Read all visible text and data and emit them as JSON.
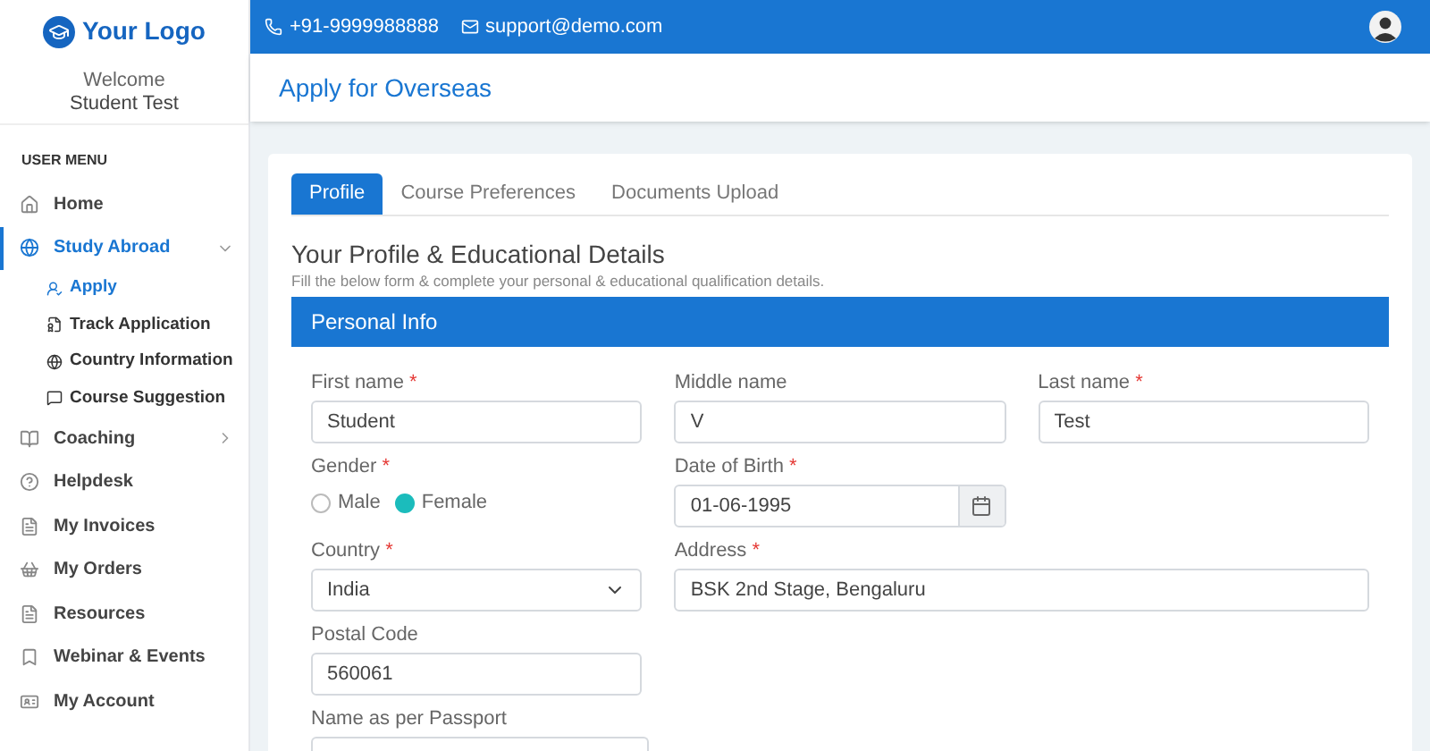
{
  "logo": {
    "text": "Your Logo"
  },
  "topbar": {
    "phone": "+91-9999988888",
    "email": "support@demo.com"
  },
  "welcome": {
    "greeting": "Welcome",
    "name": "Student Test"
  },
  "sidebar": {
    "heading": "USER MENU",
    "items": [
      {
        "label": "Home",
        "selected": false
      },
      {
        "label": "Study Abroad",
        "selected": true,
        "expanded": true,
        "children": [
          {
            "label": "Apply",
            "selected": true
          },
          {
            "label": "Track Application",
            "selected": false
          },
          {
            "label": "Country Information",
            "selected": false
          },
          {
            "label": "Course Suggestion",
            "selected": false
          }
        ]
      },
      {
        "label": "Coaching",
        "selected": false,
        "expanded": false
      },
      {
        "label": "Helpdesk",
        "selected": false
      },
      {
        "label": "My Invoices",
        "selected": false
      },
      {
        "label": "My Orders",
        "selected": false
      },
      {
        "label": "Resources",
        "selected": false
      },
      {
        "label": "Webinar & Events",
        "selected": false
      },
      {
        "label": "My Account",
        "selected": false
      }
    ]
  },
  "page_title": "Apply for Overseas",
  "tabs": [
    {
      "label": "Profile",
      "selected": true
    },
    {
      "label": "Course Preferences",
      "selected": false
    },
    {
      "label": "Documents Upload",
      "selected": false
    }
  ],
  "section": {
    "title": "Your Profile & Educational Details",
    "subtitle": "Fill the below form & complete your personal & educational qualification details."
  },
  "panel_title": "Personal Info",
  "fields": [
    {
      "kind": "text",
      "label": "First name",
      "required_mark": "*",
      "value": "Student"
    },
    {
      "kind": "text",
      "label": "Middle name",
      "value": "V"
    },
    {
      "kind": "text",
      "label": "Last name",
      "required_mark": "*",
      "value": "Test"
    },
    {
      "kind": "radio",
      "label": "Gender",
      "required_mark": "*",
      "options": [
        {
          "label": "Male",
          "selected": false
        },
        {
          "label": "Female",
          "selected": true
        }
      ]
    },
    {
      "kind": "date",
      "label": "Date of Birth",
      "required_mark": "*",
      "value": "01-06-1995"
    },
    {
      "kind": "spacer"
    },
    {
      "kind": "select",
      "label": "Country",
      "required_mark": "*",
      "value": "India"
    },
    {
      "kind": "wide",
      "label": "Address",
      "required_mark": "*",
      "value": "BSK 2nd Stage, Bengaluru"
    },
    {
      "kind": "text",
      "label": "Postal Code",
      "value": "560061"
    },
    {
      "kind": "spacer"
    },
    {
      "kind": "cut",
      "label": "Name as per Passport"
    }
  ]
}
